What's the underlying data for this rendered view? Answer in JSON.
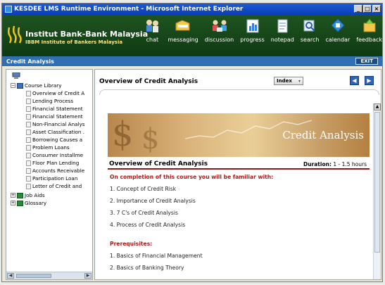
{
  "window": {
    "title": "KESDEE LMS Runtime Environment - Microsoft Internet Explorer",
    "controls": [
      "_",
      "□",
      "×"
    ]
  },
  "header": {
    "brand_name": "Institut Bank-Bank Malaysia",
    "brand_sub": "IBBM  Institute of Bankers Malaysia",
    "nav": [
      {
        "label": "chat",
        "icon": "chat-icon"
      },
      {
        "label": "messaging",
        "icon": "messaging-icon"
      },
      {
        "label": "discussion",
        "icon": "discussion-icon"
      },
      {
        "label": "progress",
        "icon": "progress-icon"
      },
      {
        "label": "notepad",
        "icon": "notepad-icon"
      },
      {
        "label": "search",
        "icon": "search-icon"
      },
      {
        "label": "calendar",
        "icon": "calendar-icon"
      },
      {
        "label": "feedback",
        "icon": "feedback-icon"
      }
    ]
  },
  "coursebar": {
    "title": "Credit Analysis",
    "exit_label": "EXIT"
  },
  "tree": {
    "root_label": "Course Library",
    "items": [
      "Overview of Credit A",
      "Lending Process",
      "Financial Statement",
      "Financial Statement",
      "Non-Financial Analys",
      "Asset Classification .",
      "Borrowing Causes a",
      "Problem Loans",
      "Consumer Installme",
      "Floor Plan Lending",
      "Accounts Receivable",
      "Participation Loan",
      "Letter of Credit and"
    ],
    "job_aids": "Job Aids",
    "glossary": "Glossary"
  },
  "main": {
    "overview_title": "Overview of Credit Analysis",
    "index_label": "Index",
    "banner_title": "Credit Analysis",
    "course_title": "Overview of Credit Analysis",
    "duration_label": "Duration:",
    "duration_value": "1 - 1.5 hours",
    "objectives_heading": "On completion of this course you will be familiar with:",
    "objectives": [
      "1.  Concept of Credit Risk",
      "2.  Importance of Credit Analysis",
      "3.  7 C's of Credit Analysis",
      "4.  Process of Credit Analysis"
    ],
    "prereq_heading": "Prerequisites:",
    "prerequisites": [
      "1.  Basics of Financial Management",
      "2.  Basics of Banking Theory"
    ]
  }
}
